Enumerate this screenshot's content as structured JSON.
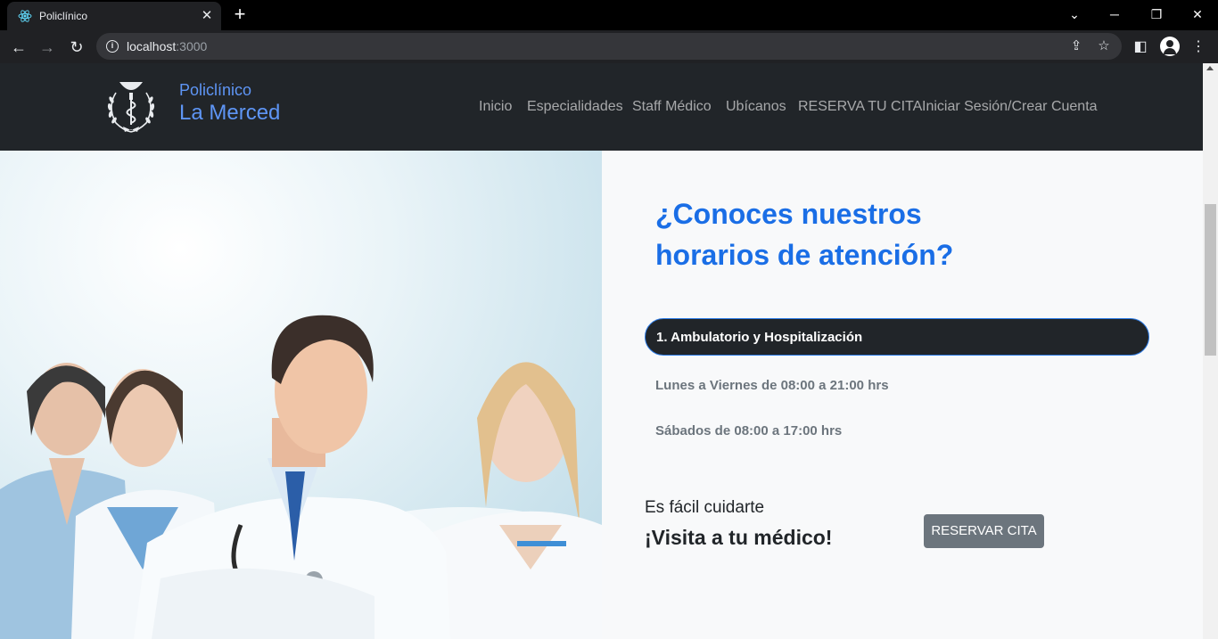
{
  "browser": {
    "tab_title": "Policlínico",
    "tab_close": "✕",
    "new_tab": "+",
    "url_host": "localhost",
    "url_port": ":3000"
  },
  "site": {
    "brand_line1": "Policlínico",
    "brand_line2": "La Merced",
    "menu": [
      "Inicio",
      "Especialidades",
      "Staff Médico",
      "Ubícanos",
      "RESERVA TU CITA",
      "Iniciar Sesión/Crear Cuenta"
    ]
  },
  "main": {
    "heading_line1": "¿Conoces nuestros",
    "heading_line2": "horarios de atención?",
    "accordion_title": "1. Ambulatorio y Hospitalización",
    "hours_weekdays": "Lunes a Viernes de 08:00 a 21:00 hrs",
    "hours_saturday": "Sábados de 08:00 a 17:00 hrs",
    "cta_small": "Es fácil cuidarte",
    "cta_big": "¡Visita a tu médico!",
    "cta_button": "RESERVAR CITA"
  },
  "colors": {
    "accent": "#1a6ee6",
    "navbar": "#212529",
    "button": "#6c757d"
  }
}
